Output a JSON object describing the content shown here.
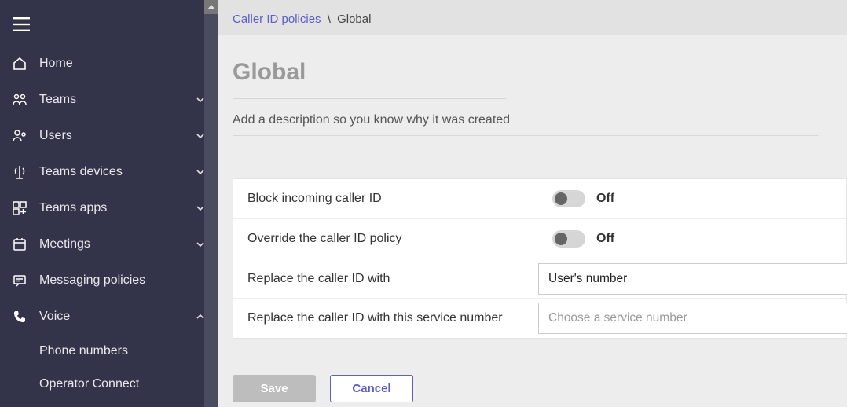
{
  "sidebar": {
    "items": [
      {
        "label": "Home",
        "chev": null
      },
      {
        "label": "Teams",
        "chev": "down"
      },
      {
        "label": "Users",
        "chev": "down"
      },
      {
        "label": "Teams devices",
        "chev": "down"
      },
      {
        "label": "Teams apps",
        "chev": "down"
      },
      {
        "label": "Meetings",
        "chev": "down"
      },
      {
        "label": "Messaging policies",
        "chev": null
      },
      {
        "label": "Voice",
        "chev": "up"
      }
    ],
    "subitems": [
      {
        "label": "Phone numbers"
      },
      {
        "label": "Operator Connect"
      }
    ]
  },
  "breadcrumb": {
    "parent": "Caller ID policies",
    "current": "Global"
  },
  "page": {
    "title": "Global",
    "description_placeholder": "Add a description so you know why it was created"
  },
  "settings": {
    "row1_label": "Block incoming caller ID",
    "row1_state": "Off",
    "row2_label": "Override the caller ID policy",
    "row2_state": "Off",
    "row3_label": "Replace the caller ID with",
    "row3_value": "User's number",
    "row4_label": "Replace the caller ID with this service number",
    "row4_placeholder": "Choose a service number"
  },
  "actions": {
    "save": "Save",
    "cancel": "Cancel"
  }
}
